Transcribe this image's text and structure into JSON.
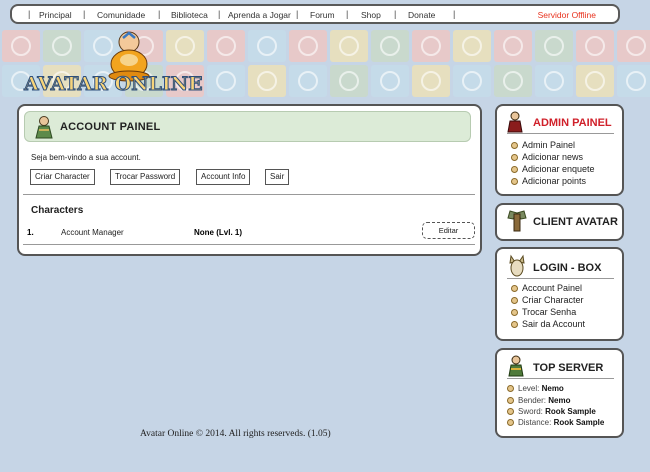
{
  "nav": {
    "items": [
      "Principal",
      "Comunidade",
      "Biblioteca",
      "Aprenda a Jogar",
      "Forum",
      "Shop",
      "Donate"
    ],
    "server_status": "Servidor Offline"
  },
  "logo": {
    "text": "AVATAR ONLINE"
  },
  "account": {
    "title": "ACCOUNT PAINEL",
    "welcome": "Seja bem-vindo a sua account.",
    "buttons": [
      "Criar Character",
      "Trocar Password",
      "Account Info",
      "Sair"
    ],
    "characters_title": "Characters",
    "characters": [
      {
        "num": "1.",
        "name": "Account Manager",
        "level": "None (Lvl. 1)",
        "action": "Editar"
      }
    ]
  },
  "admin": {
    "title": "ADMIN PAINEL",
    "items": [
      "Admin Painel",
      "Adicionar news",
      "Adicionar enquete",
      "Adicionar points"
    ]
  },
  "client": {
    "title": "CLIENT AVATAR"
  },
  "login": {
    "title": "LOGIN - BOX",
    "items": [
      "Account Painel",
      "Criar Character",
      "Trocar Senha",
      "Sair da Account"
    ]
  },
  "top": {
    "title": "TOP SERVER",
    "stats": [
      {
        "label": "Level:",
        "value": "Nemo"
      },
      {
        "label": "Bender:",
        "value": "Nemo"
      },
      {
        "label": "Sword:",
        "value": "Rook Sample"
      },
      {
        "label": "Distance:",
        "value": "Rook Sample"
      }
    ]
  },
  "footer": "Avatar Online © 2014. All rights reserveds. (1.05)",
  "colors": {
    "admin_title": "#d0202a",
    "server_offline": "#e8321e",
    "header_bg": "#dcebd7",
    "page_bg": "#c6d5e6"
  }
}
